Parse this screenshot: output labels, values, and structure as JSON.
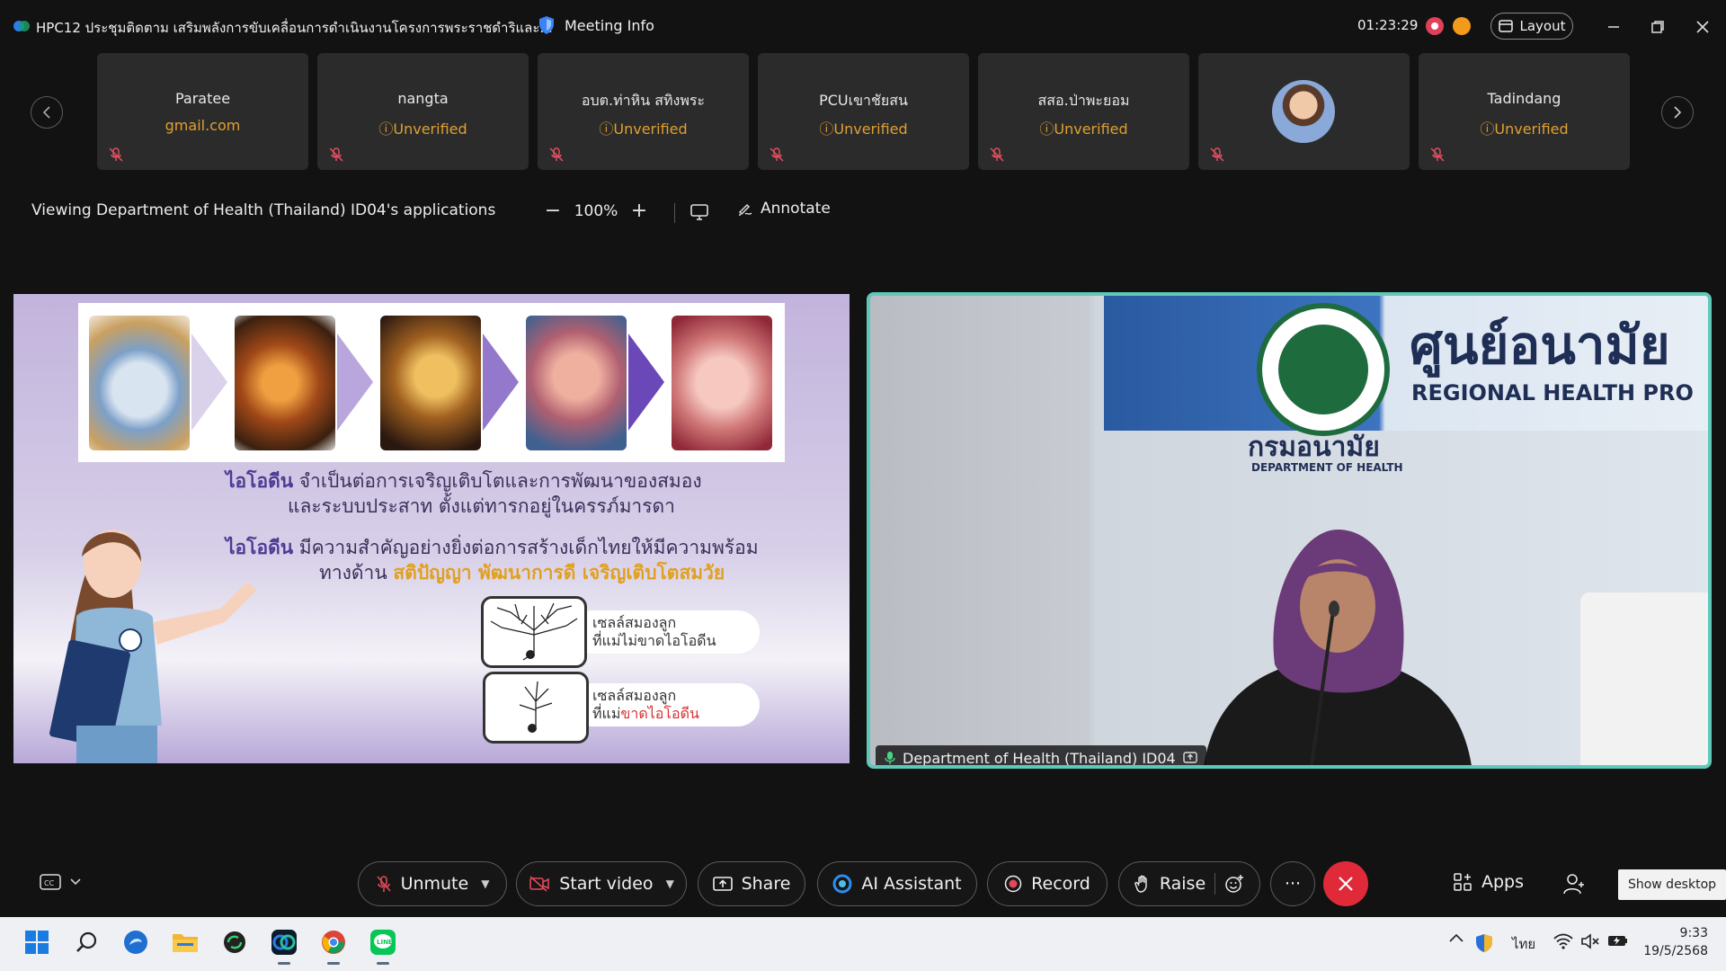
{
  "window": {
    "title": "HPC12 ประชุมติดตาม เสริมพลังการขับเคลื่อนการดำเนินงานโครงการพระราชดำริและ...",
    "meeting_info_label": "Meeting Info",
    "timer": "01:23:29",
    "layout_label": "Layout"
  },
  "participants": [
    {
      "name": "Paratee",
      "sub": "gmail.com",
      "sub_type": "email"
    },
    {
      "name": "nangta",
      "sub": "Unverified",
      "sub_type": "unverified"
    },
    {
      "name": "อบต.ท่าหิน สทิงพระ",
      "sub": "Unverified",
      "sub_type": "unverified"
    },
    {
      "name": "PCUเขาชัยสน",
      "sub": "Unverified",
      "sub_type": "unverified"
    },
    {
      "name": "สสอ.ป่าพะยอม",
      "sub": "Unverified",
      "sub_type": "unverified"
    },
    {
      "name": "",
      "sub": "",
      "sub_type": "avatar"
    },
    {
      "name": "Tadindang",
      "sub": "Unverified",
      "sub_type": "unverified"
    }
  ],
  "share": {
    "viewing_text": "Viewing Department of Health (Thailand) ID04's applications",
    "zoom": "100%",
    "annotate_label": "Annotate"
  },
  "slide": {
    "line1_em": "ไอโอดีน",
    "line1": " จำเป็นต่อการเจริญเติบโตและการพัฒนาของสมอง",
    "line2": "และระบบประสาท ตั้งแต่ทารกอยู่ในครรภ์มารดา",
    "line3_em": "ไอโอดีน",
    "line3": " มีความสำคัญอย่างยิ่งต่อการสร้างเด็กไทยให้มีความพร้อม",
    "line4_pre": "ทางด้าน ",
    "line4_hl": "สติปัญญา พัฒนาการดี เจริญเติบโตสมวัย",
    "cell1_a": "เซลล์สมองลูก",
    "cell1_b": "ที่แม่ไม่ขาดไอโอดีน",
    "cell2_a": "เซลล์สมองลูก",
    "cell2_b_pre": "ที่แม่",
    "cell2_b_red": "ขาดไอโอดีน"
  },
  "video": {
    "speaker_label": "Department of Health (Thailand) ID04",
    "sign_big_th": "ศูนย์อนามัย",
    "sign_big_en": "REGIONAL HEALTH PRO",
    "sign_th": "กรมอนามัย",
    "sign_en": "DEPARTMENT OF HEALTH"
  },
  "toolbar": {
    "unmute": "Unmute",
    "start_video": "Start video",
    "share": "Share",
    "ai_assistant": "AI Assistant",
    "record": "Record",
    "raise": "Raise",
    "more": "···",
    "apps": "Apps",
    "tooltip": "Show desktop"
  },
  "taskbar": {
    "language": "ไทย",
    "time": "9:33",
    "date": "19/5/2568"
  },
  "colors": {
    "accent_teal": "#5fc9b9",
    "end_red": "#e02a3a",
    "unverified": "#e0a030"
  }
}
